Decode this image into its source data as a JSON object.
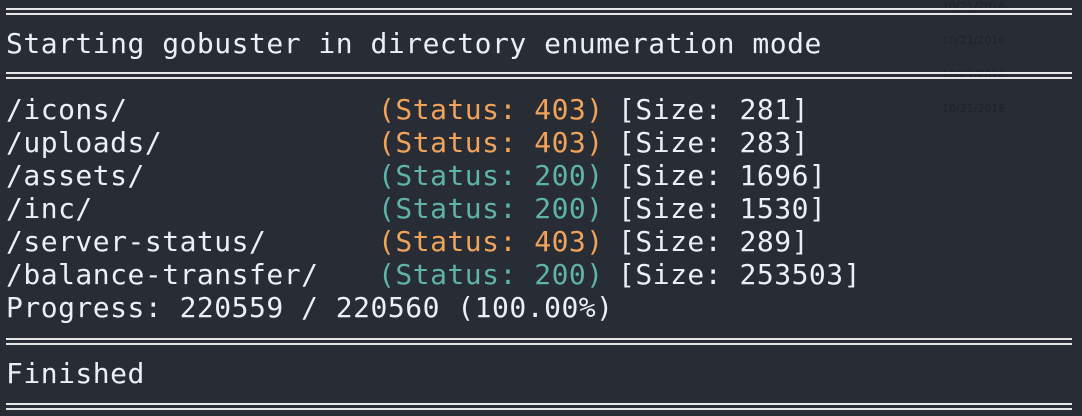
{
  "header": {
    "title": "Starting gobuster in directory enumeration mode"
  },
  "results": [
    {
      "path": "/icons/",
      "status": "(Status: 403)",
      "size": "[Size: 281]",
      "code": "403"
    },
    {
      "path": "/uploads/",
      "status": "(Status: 403)",
      "size": "[Size: 283]",
      "code": "403"
    },
    {
      "path": "/assets/",
      "status": "(Status: 200)",
      "size": "[Size: 1696]",
      "code": "200"
    },
    {
      "path": "/inc/",
      "status": "(Status: 200)",
      "size": "[Size: 1530]",
      "code": "200"
    },
    {
      "path": "/server-status/",
      "status": "(Status: 403)",
      "size": "[Size: 289]",
      "code": "403"
    },
    {
      "path": "/balance-transfer/",
      "status": "(Status: 200)",
      "size": "[Size: 253503]",
      "code": "200"
    }
  ],
  "progress": {
    "text": "Progress: 220559 / 220560 (100.00%)"
  },
  "footer": {
    "text": "Finished"
  },
  "background_dates": [
    "10/21/2016",
    "10/21/2016",
    "10/21/2016",
    "10/21/2016"
  ],
  "colors": {
    "background": "#282c34",
    "text": "#eceff4",
    "status_403": "#f0a35a",
    "status_200": "#5fb3a8"
  }
}
